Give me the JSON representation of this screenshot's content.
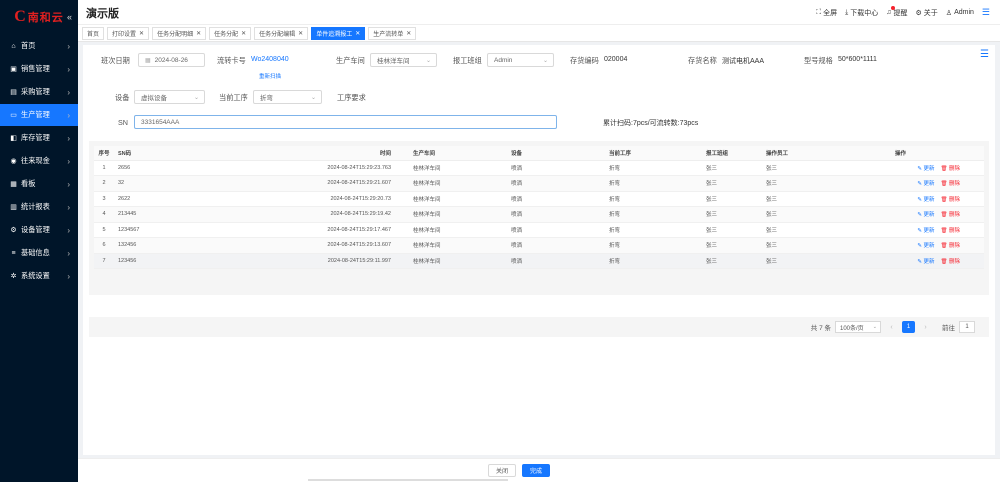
{
  "logo": {
    "mark": "C",
    "text": "南和云"
  },
  "sidebar": {
    "collapse_icon": "«",
    "items": [
      {
        "label": "首页",
        "icon": "home-icon"
      },
      {
        "label": "销售管理",
        "icon": "cart-icon"
      },
      {
        "label": "采购管理",
        "icon": "truck-icon"
      },
      {
        "label": "生产管理",
        "icon": "monitor-icon",
        "active": true
      },
      {
        "label": "库存管理",
        "icon": "box-icon"
      },
      {
        "label": "往来现金",
        "icon": "cash-icon"
      },
      {
        "label": "看板",
        "icon": "board-icon"
      },
      {
        "label": "统计报表",
        "icon": "chart-icon"
      },
      {
        "label": "设备管理",
        "icon": "gear-icon"
      },
      {
        "label": "基础信息",
        "icon": "list-icon"
      },
      {
        "label": "系统设置",
        "icon": "settings-icon"
      }
    ]
  },
  "header": {
    "title": "演示版",
    "fullscreen": "全屏",
    "download": "下载中心",
    "remind": "提醒",
    "about": "关于",
    "user": "Admin"
  },
  "tabs": [
    {
      "label": "首页",
      "closable": false
    },
    {
      "label": "打印设置",
      "closable": true
    },
    {
      "label": "任务分配明细",
      "closable": true
    },
    {
      "label": "任务分配",
      "closable": true
    },
    {
      "label": "任务分配编辑",
      "closable": true
    },
    {
      "label": "单件追溯报工",
      "closable": true,
      "active": true
    },
    {
      "label": "生产流转单",
      "closable": true
    }
  ],
  "form": {
    "shift_date_label": "班次日期",
    "shift_date_value": "2024-08-26",
    "flow_card_label": "流转卡号",
    "flow_card_value": "Wo2408040",
    "rescan": "重新扫描",
    "workshop_label": "生产车间",
    "workshop_value": "桂林洋车间",
    "team_label": "报工班组",
    "team_value": "Admin",
    "inventory_code_label": "存货编码",
    "inventory_code_value": "020004",
    "inventory_name_label": "存货名称",
    "inventory_name_value": "测试电机AAA",
    "spec_label": "型号规格",
    "spec_value": "50*600*1111",
    "device_label": "设备",
    "device_value": "虚拟设备",
    "process_label": "当前工序",
    "process_value": "折弯",
    "requirement_label": "工序要求",
    "sn_label": "SN",
    "sn_value": "3331654AAA",
    "scan_summary": "累计扫码:7pcs/可流转数:73pcs"
  },
  "table": {
    "headers": [
      "序号",
      "SN码",
      "时间",
      "生产车间",
      "设备",
      "当前工序",
      "报工班组",
      "操作员工",
      "操作"
    ],
    "edit_label": "更新",
    "delete_label": "删除",
    "rows": [
      {
        "no": "1",
        "sn": "2656",
        "time": "2024-08-24T15:29:23.763",
        "workshop": "桂林洋车间",
        "device": "喷洒",
        "process": "折弯",
        "team": "张三",
        "operator": "张三"
      },
      {
        "no": "2",
        "sn": "32",
        "time": "2024-08-24T15:29:21.607",
        "workshop": "桂林洋车间",
        "device": "喷洒",
        "process": "折弯",
        "team": "张三",
        "operator": "张三"
      },
      {
        "no": "3",
        "sn": "2622",
        "time": "2024-08-24T15:29:20.73",
        "workshop": "桂林洋车间",
        "device": "喷洒",
        "process": "折弯",
        "team": "张三",
        "operator": "张三"
      },
      {
        "no": "4",
        "sn": "213445",
        "time": "2024-08-24T15:29:19.42",
        "workshop": "桂林洋车间",
        "device": "喷洒",
        "process": "折弯",
        "team": "张三",
        "operator": "张三"
      },
      {
        "no": "5",
        "sn": "1234567",
        "time": "2024-08-24T15:29:17.467",
        "workshop": "桂林洋车间",
        "device": "喷洒",
        "process": "折弯",
        "team": "张三",
        "operator": "张三"
      },
      {
        "no": "6",
        "sn": "132456",
        "time": "2024-08-24T15:29:13.607",
        "workshop": "桂林洋车间",
        "device": "喷洒",
        "process": "折弯",
        "team": "张三",
        "operator": "张三"
      },
      {
        "no": "7",
        "sn": "123456",
        "time": "2024-08-24T15:29:11.997",
        "workshop": "桂林洋车间",
        "device": "喷洒",
        "process": "折弯",
        "team": "张三",
        "operator": "张三"
      }
    ]
  },
  "pager": {
    "total": "共 7 条",
    "page_size": "100条/页",
    "current": "1",
    "goto_label": "前往",
    "goto_value": "1"
  },
  "footer": {
    "close_label": "关闭",
    "done_label": "完成"
  }
}
